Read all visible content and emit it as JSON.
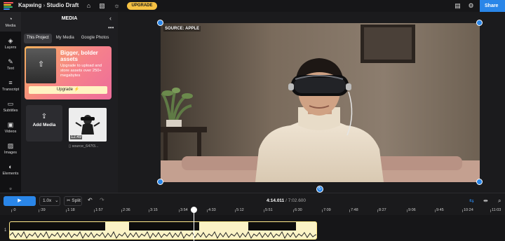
{
  "topbar": {
    "brand": "Kapwing",
    "separator": "›",
    "project": "Studio Draft",
    "upgrade_label": "UPGRADE",
    "share_label": "Share"
  },
  "rail": [
    {
      "label": "Media",
      "icon": "media-icon",
      "glyph": "◔",
      "active": true
    },
    {
      "label": "Layers",
      "icon": "layers-icon",
      "glyph": "◈",
      "active": false
    },
    {
      "label": "Text",
      "icon": "text-icon",
      "glyph": "✎",
      "active": false
    },
    {
      "label": "Transcript",
      "icon": "transcript-icon",
      "glyph": "≡",
      "active": false
    },
    {
      "label": "Subtitles",
      "icon": "subtitles-icon",
      "glyph": "▭",
      "active": false
    },
    {
      "label": "Videos",
      "icon": "videos-icon",
      "glyph": "▣",
      "active": false
    },
    {
      "label": "Images",
      "icon": "images-icon",
      "glyph": "▨",
      "active": false
    },
    {
      "label": "Elements",
      "icon": "elements-icon",
      "glyph": "◐",
      "active": false
    }
  ],
  "panel": {
    "title": "MEDIA",
    "tabs": [
      "This Project",
      "My Media",
      "Google Photos"
    ],
    "promo": {
      "title": "Bigger, bolder assets",
      "text": "Upgrade to upload and store assets over 250+ megabytes",
      "button": "Upgrade ⚡"
    },
    "add_media": "Add Media",
    "asset": {
      "duration": "12:49",
      "name": "source_647f3..."
    }
  },
  "canvas": {
    "source_label": "SOURCE: APPLE"
  },
  "timeline": {
    "play_glyph": "▶",
    "speed": "1.0x",
    "split": "Split",
    "current_time": "4:14.011",
    "total_time": "/ 7:02.600",
    "ruler": [
      ":0",
      ":39",
      "1:18",
      "1:57",
      "2:36",
      "3:15",
      "3:54",
      "4:33",
      "5:12",
      "5:51",
      "6:30",
      "7:09",
      "7:48",
      "8:27",
      "9:06",
      "9:45",
      "10:24",
      "11:03"
    ],
    "track_number": "1"
  },
  "colors": {
    "accent": "#2a86e8",
    "upgrade": "#f6c143",
    "clip": "#fbf3c6"
  }
}
